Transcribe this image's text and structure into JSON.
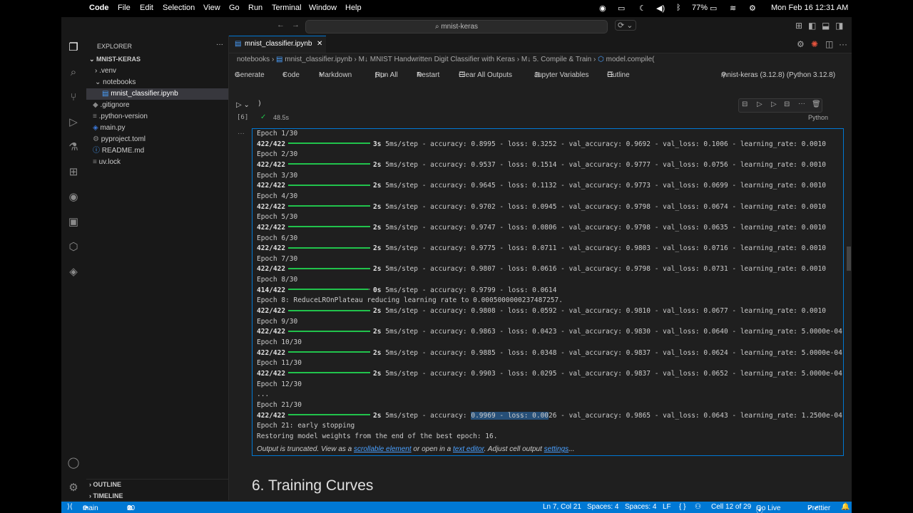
{
  "menubar": {
    "app": "Code",
    "items": [
      "File",
      "Edit",
      "Selection",
      "View",
      "Go",
      "Run",
      "Terminal",
      "Window",
      "Help"
    ],
    "battery": "77%",
    "datetime": "Mon Feb 16  12:31 AM"
  },
  "command_center": "mnist-keras",
  "explorer": {
    "title": "EXPLORER",
    "root": "MNIST-KERAS",
    "items": [
      ".venv",
      "notebooks",
      "mnist_classifier.ipynb",
      ".gitignore",
      ".python-version",
      "main.py",
      "pyproject.toml",
      "README.md",
      "uv.lock"
    ],
    "outline": "OUTLINE",
    "timeline": "TIMELINE"
  },
  "tab": {
    "label": "mnist_classifier.ipynb"
  },
  "breadcrumb": {
    "items": [
      "notebooks",
      "mnist_classifier.ipynb",
      "M↓ MNIST Handwritten Digit Classifier with Keras",
      "M↓ 5. Compile & Train",
      "model.compile("
    ]
  },
  "notebook_toolbar": {
    "generate": "Generate",
    "code": "Code",
    "markdown": "Markdown",
    "run_all": "Run All",
    "restart": "Restart",
    "clear": "Clear All Outputs",
    "variables": "Jupyter Variables",
    "outline": "Outline",
    "kernel": "mnist-keras (3.12.8) (Python 3.12.8)"
  },
  "cell": {
    "code_tail": ")",
    "exec_count": "[6]",
    "duration": "48.5s",
    "language": "Python"
  },
  "output_lines": [
    {
      "kind": "epoch",
      "text": "Epoch 1/30"
    },
    {
      "kind": "step",
      "count": "422/422",
      "time": "3s",
      "rest": "5ms/step - accuracy: 0.8995 - loss: 0.3252 - val_accuracy: 0.9692 - val_loss: 0.1006 - learning_rate: 0.0010"
    },
    {
      "kind": "epoch",
      "text": "Epoch 2/30"
    },
    {
      "kind": "step",
      "count": "422/422",
      "time": "2s",
      "rest": "5ms/step - accuracy: 0.9537 - loss: 0.1514 - val_accuracy: 0.9777 - val_loss: 0.0756 - learning_rate: 0.0010"
    },
    {
      "kind": "epoch",
      "text": "Epoch 3/30"
    },
    {
      "kind": "step",
      "count": "422/422",
      "time": "2s",
      "rest": "5ms/step - accuracy: 0.9645 - loss: 0.1132 - val_accuracy: 0.9773 - val_loss: 0.0699 - learning_rate: 0.0010"
    },
    {
      "kind": "epoch",
      "text": "Epoch 4/30"
    },
    {
      "kind": "step",
      "count": "422/422",
      "time": "2s",
      "rest": "5ms/step - accuracy: 0.9702 - loss: 0.0945 - val_accuracy: 0.9798 - val_loss: 0.0674 - learning_rate: 0.0010"
    },
    {
      "kind": "epoch",
      "text": "Epoch 5/30"
    },
    {
      "kind": "step",
      "count": "422/422",
      "time": "2s",
      "rest": "5ms/step - accuracy: 0.9747 - loss: 0.0806 - val_accuracy: 0.9798 - val_loss: 0.0635 - learning_rate: 0.0010"
    },
    {
      "kind": "epoch",
      "text": "Epoch 6/30"
    },
    {
      "kind": "step",
      "count": "422/422",
      "time": "2s",
      "rest": "5ms/step - accuracy: 0.9775 - loss: 0.0711 - val_accuracy: 0.9803 - val_loss: 0.0716 - learning_rate: 0.0010"
    },
    {
      "kind": "epoch",
      "text": "Epoch 7/30"
    },
    {
      "kind": "step",
      "count": "422/422",
      "time": "2s",
      "rest": "5ms/step - accuracy: 0.9807 - loss: 0.0616 - val_accuracy: 0.9798 - val_loss: 0.0731 - learning_rate: 0.0010"
    },
    {
      "kind": "epoch",
      "text": "Epoch 8/30"
    },
    {
      "kind": "step",
      "count": "414/422",
      "time": "0s",
      "partial": true,
      "rest": "5ms/step - accuracy: 0.9799 - loss: 0.0614"
    },
    {
      "kind": "epoch",
      "text": "Epoch 8: ReduceLROnPlateau reducing learning rate to 0.0005000000237487257."
    },
    {
      "kind": "step",
      "count": "422/422",
      "time": "2s",
      "rest": "5ms/step - accuracy: 0.9808 - loss: 0.0592 - val_accuracy: 0.9810 - val_loss: 0.0677 - learning_rate: 0.0010"
    },
    {
      "kind": "epoch",
      "text": "Epoch 9/30"
    },
    {
      "kind": "step",
      "count": "422/422",
      "time": "2s",
      "rest": "5ms/step - accuracy: 0.9863 - loss: 0.0423 - val_accuracy: 0.9830 - val_loss: 0.0640 - learning_rate: 5.0000e-04"
    },
    {
      "kind": "epoch",
      "text": "Epoch 10/30"
    },
    {
      "kind": "step",
      "count": "422/422",
      "time": "2s",
      "rest": "5ms/step - accuracy: 0.9885 - loss: 0.0348 - val_accuracy: 0.9837 - val_loss: 0.0624 - learning_rate: 5.0000e-04"
    },
    {
      "kind": "epoch",
      "text": "Epoch 11/30"
    },
    {
      "kind": "step",
      "count": "422/422",
      "time": "2s",
      "rest": "5ms/step - accuracy: 0.9903 - loss: 0.0295 - val_accuracy: 0.9837 - val_loss: 0.0652 - learning_rate: 5.0000e-04"
    },
    {
      "kind": "epoch",
      "text": "Epoch 12/30"
    },
    {
      "kind": "epoch",
      "text": "..."
    },
    {
      "kind": "epoch",
      "text": "Epoch 21/30"
    },
    {
      "kind": "step",
      "count": "422/422",
      "time": "2s",
      "rest_pre": "5ms/step - accuracy: ",
      "rest_sel": "0.9969 - loss: 0.00",
      "rest_post": "26 - val_accuracy: 0.9865 - val_loss: 0.0643 - learning_rate: 1.2500e-04"
    },
    {
      "kind": "epoch",
      "text": "Epoch 21: early stopping"
    },
    {
      "kind": "epoch",
      "text": "Restoring model weights from the end of the best epoch: 16."
    }
  ],
  "truncated": {
    "pre": "Output is truncated. View as a ",
    "link1": "scrollable element",
    "mid": " or open in a ",
    "link2": "text editor",
    "mid2": ". Adjust cell output ",
    "link3": "settings",
    "post": "..."
  },
  "section_heading": "6. Training Curves",
  "statusbar": {
    "branch": "main",
    "errors": "0",
    "warnings": "10",
    "position": "Ln 7, Col 21",
    "spaces1": "Spaces: 4",
    "spaces2": "Spaces: 4",
    "eol": "LF",
    "braces": "{ }",
    "cell": "Cell 12 of 29",
    "golive": "Go Live",
    "prettier": "Prettier"
  }
}
